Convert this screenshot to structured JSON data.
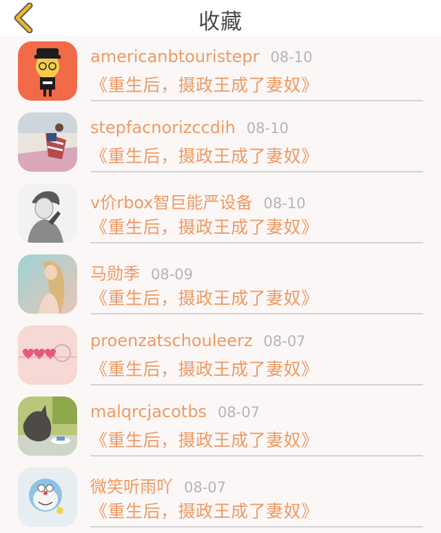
{
  "header": {
    "title": "收藏",
    "back_icon": "chevron-left-icon",
    "accent_color": "#e8b92c"
  },
  "items": [
    {
      "name": "americanbtouristepr",
      "date": "08-10",
      "book": "《重生后，摄政王成了妻奴》",
      "avatar": "cartoon-girl-avatar"
    },
    {
      "name": "stepfacnorizccdih",
      "date": "08-10",
      "book": "《重生后，摄政王成了妻奴》",
      "avatar": "flag-girl-avatar"
    },
    {
      "name": "v价rbox智巨能严设备",
      "date": "08-10",
      "book": "《重生后，摄政王成了妻奴》",
      "avatar": "sketch-boy-avatar"
    },
    {
      "name": "马勋季",
      "date": "08-09",
      "book": "《重生后，摄政王成了妻奴》",
      "avatar": "blonde-girl-avatar"
    },
    {
      "name": "proenzatschouleerz",
      "date": "08-07",
      "book": "《重生后，摄政王成了妻奴》",
      "avatar": "hearts-avatar"
    },
    {
      "name": "malqrcjacotbs",
      "date": "08-07",
      "book": "《重生后，摄政王成了妻奴》",
      "avatar": "cat-avatar"
    },
    {
      "name": "微笑听雨吖",
      "date": "08-07",
      "book": "《重生后，摄政王成了妻奴》",
      "avatar": "doraemon-avatar"
    }
  ],
  "colors": {
    "name": "#ee9a62",
    "date": "#b5b5b5",
    "divider": "#d2d2d2",
    "background": "#fbf7f7"
  }
}
